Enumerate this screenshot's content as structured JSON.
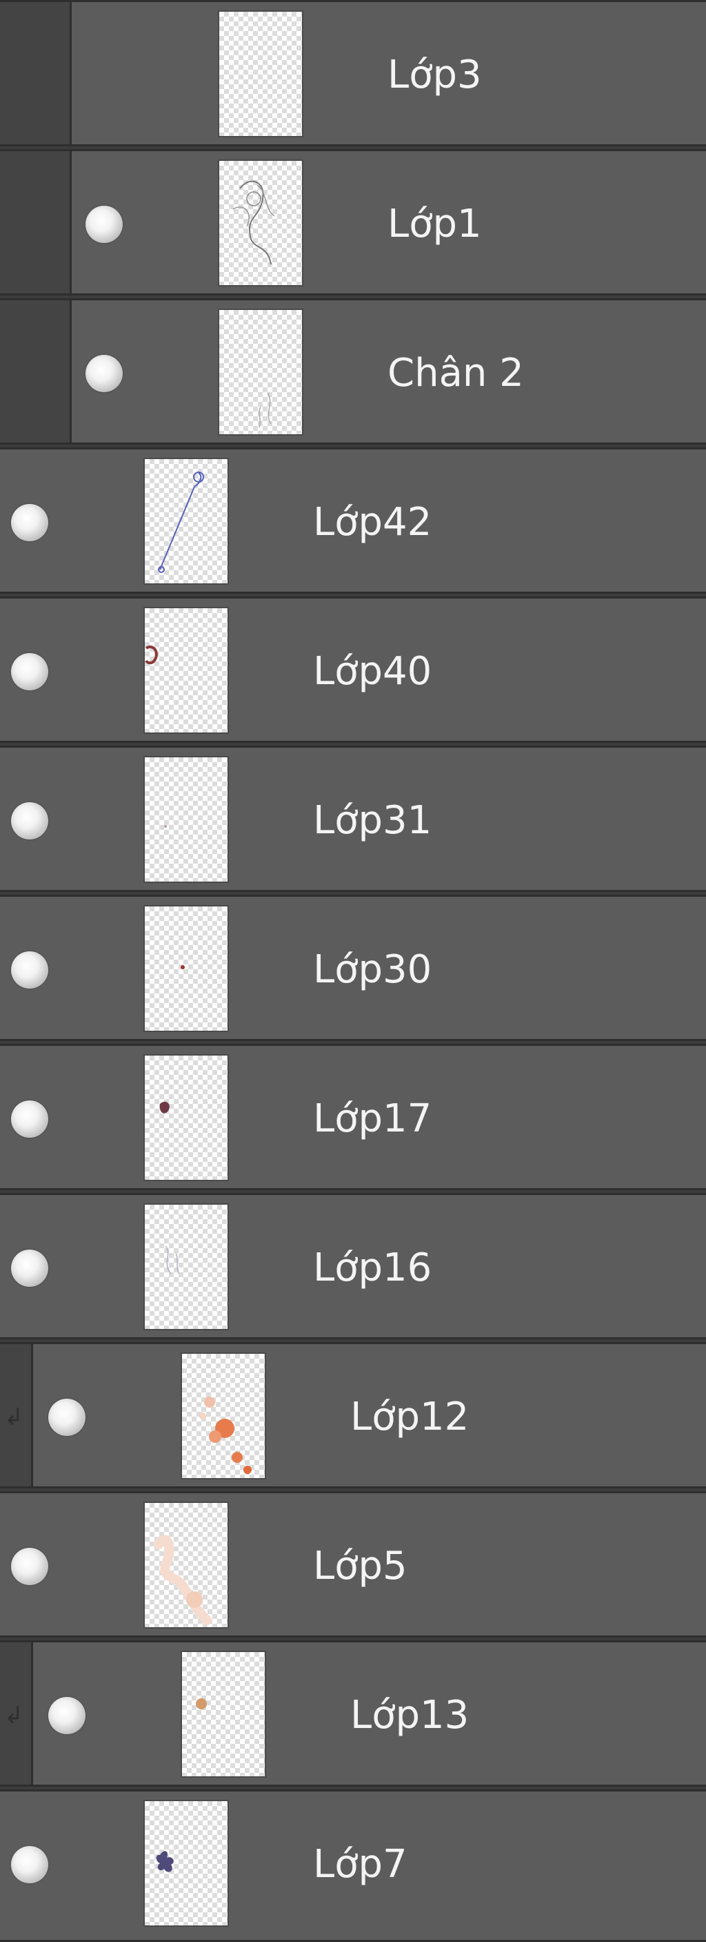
{
  "layers_panel": {
    "layers": [
      {
        "name": "Lớp3"
      },
      {
        "name": "Lớp1"
      },
      {
        "name": "Chân 2"
      },
      {
        "name": "Lớp42"
      },
      {
        "name": "Lớp40"
      },
      {
        "name": "Lớp31"
      },
      {
        "name": "Lớp30"
      },
      {
        "name": "Lớp17"
      },
      {
        "name": "Lớp16"
      },
      {
        "name": "Lớp12"
      },
      {
        "name": "Lớp5"
      },
      {
        "name": "Lớp13"
      },
      {
        "name": "Lớp7"
      }
    ]
  }
}
